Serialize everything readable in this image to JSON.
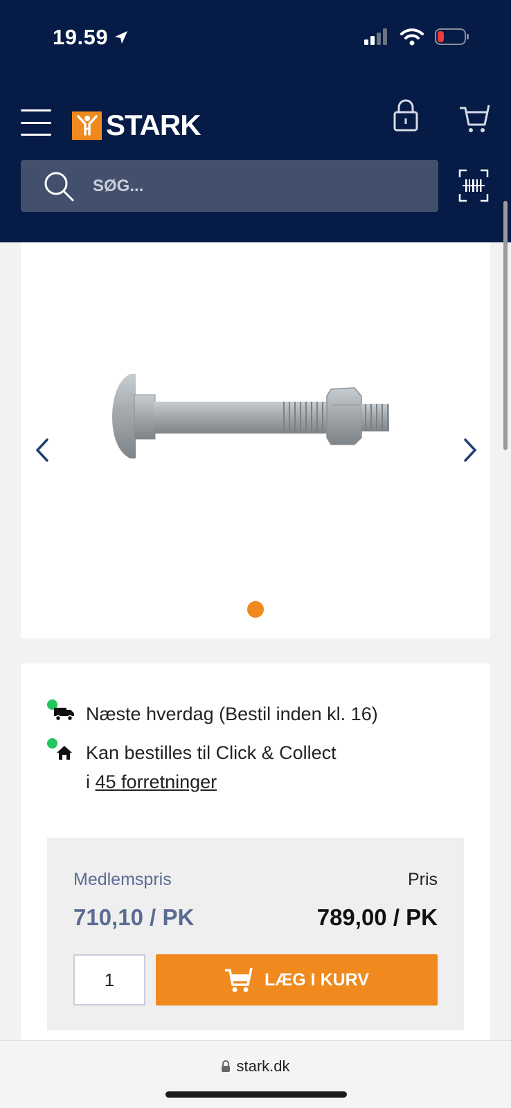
{
  "status_bar": {
    "time": "19.59"
  },
  "header": {
    "brand": "STARK",
    "search_placeholder": "SØG..."
  },
  "availability": {
    "delivery": "Næste hverdag (Bestil inden kl. 16)",
    "click_collect": "Kan bestilles til Click & Collect",
    "stores_prefix": "i",
    "stores_link": "45 forretninger"
  },
  "pricing": {
    "member_label": "Medlemspris",
    "member_price": "710,10 / PK",
    "price_label": "Pris",
    "price": "789,00 / PK",
    "quantity": "1",
    "add_to_cart": "LÆG I KURV"
  },
  "browser": {
    "url": "stark.dk"
  },
  "colors": {
    "navy": "#061b46",
    "accent_orange": "#f0891e",
    "member_blue": "#5b6b94",
    "status_green": "#22c55e"
  }
}
